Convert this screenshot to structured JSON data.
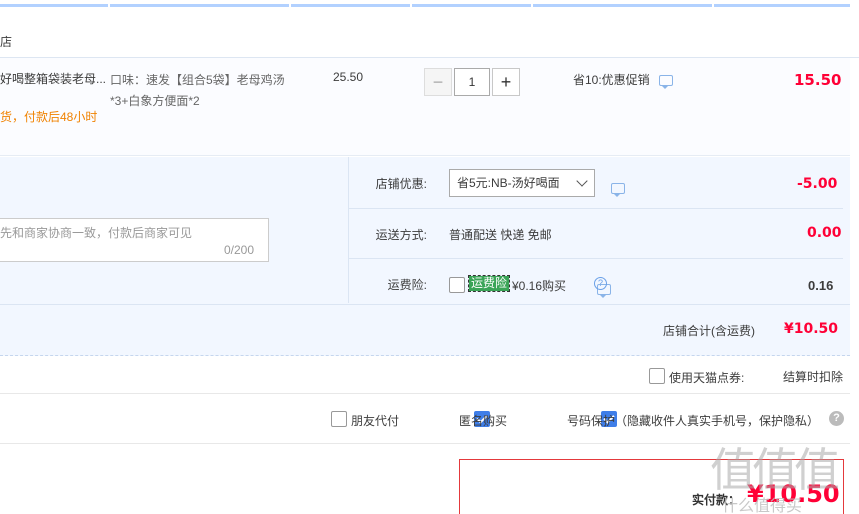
{
  "shop": {
    "name": "店"
  },
  "item": {
    "title": "好喝整箱袋装老母...",
    "note": "货，付款后48小时",
    "sku_line1": "口味：速发【组合5袋】老母鸡汤",
    "sku_line2": "*3+白象方便面*2",
    "price": "25.50",
    "qty": "1",
    "qty_minus": "−",
    "qty_plus": "+",
    "promo": "省10:优惠促销",
    "total": "15.50"
  },
  "message": {
    "placeholder": "先和商家协商一致，付款后商家可见",
    "count": "0/200"
  },
  "options": {
    "shop_discount_label": "店铺优惠:",
    "shop_discount_select": "省5元:NB-汤好喝面",
    "shop_discount_value": "-5.00",
    "shipping_label": "运送方式:",
    "shipping_value_text": "普通配送 快递 免邮",
    "shipping_value": "0.00",
    "insurance_label": "运费险:",
    "insurance_tag": "运费险",
    "insurance_price": "¥0.16购买",
    "insurance_help": "?",
    "insurance_value": "0.16"
  },
  "shop_total": {
    "label": "店铺合计(含运费)",
    "value": "¥10.50"
  },
  "coupon": {
    "label": "使用天猫点券:",
    "value": "结算时扣除"
  },
  "checks": {
    "friend_pay": "朋友代付",
    "anonymous": "匿名购买",
    "number_protect": "号码保护（隐藏收件人真实手机号，保护隐私）",
    "help": "?"
  },
  "payment": {
    "label": "实付款：",
    "amount": "¥10.50"
  },
  "watermark": {
    "big": "值值值",
    "small": "什么值得买"
  },
  "colors": {
    "accent_red": "#ff0036",
    "light_blue_bg": "#f2f7ff",
    "checkbox_blue": "#3f7ee8",
    "note_orange": "#f08200"
  },
  "icons": {
    "chat": "chat-bubble-icon",
    "help": "question-circle-icon",
    "dropdown": "chevron-down-icon"
  }
}
